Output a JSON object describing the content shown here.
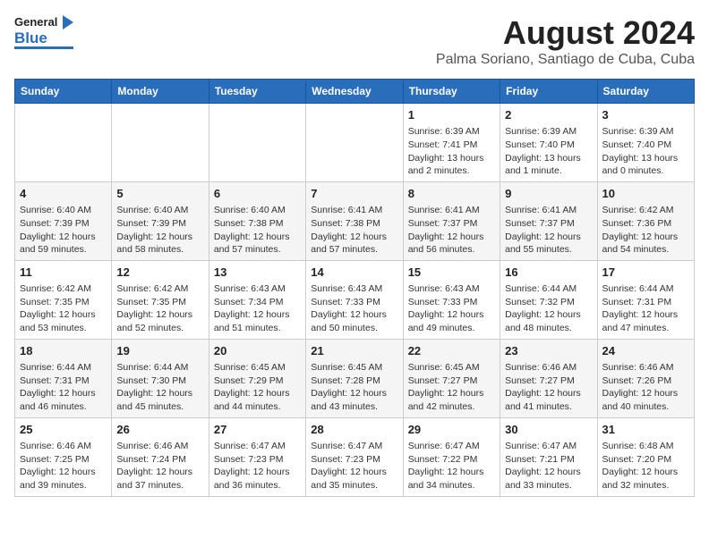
{
  "header": {
    "logo_general": "General",
    "logo_blue": "Blue",
    "title": "August 2024",
    "subtitle": "Palma Soriano, Santiago de Cuba, Cuba"
  },
  "days_of_week": [
    "Sunday",
    "Monday",
    "Tuesday",
    "Wednesday",
    "Thursday",
    "Friday",
    "Saturday"
  ],
  "weeks": [
    [
      {
        "num": "",
        "info": ""
      },
      {
        "num": "",
        "info": ""
      },
      {
        "num": "",
        "info": ""
      },
      {
        "num": "",
        "info": ""
      },
      {
        "num": "1",
        "info": "Sunrise: 6:39 AM\nSunset: 7:41 PM\nDaylight: 13 hours\nand 2 minutes."
      },
      {
        "num": "2",
        "info": "Sunrise: 6:39 AM\nSunset: 7:40 PM\nDaylight: 13 hours\nand 1 minute."
      },
      {
        "num": "3",
        "info": "Sunrise: 6:39 AM\nSunset: 7:40 PM\nDaylight: 13 hours\nand 0 minutes."
      }
    ],
    [
      {
        "num": "4",
        "info": "Sunrise: 6:40 AM\nSunset: 7:39 PM\nDaylight: 12 hours\nand 59 minutes."
      },
      {
        "num": "5",
        "info": "Sunrise: 6:40 AM\nSunset: 7:39 PM\nDaylight: 12 hours\nand 58 minutes."
      },
      {
        "num": "6",
        "info": "Sunrise: 6:40 AM\nSunset: 7:38 PM\nDaylight: 12 hours\nand 57 minutes."
      },
      {
        "num": "7",
        "info": "Sunrise: 6:41 AM\nSunset: 7:38 PM\nDaylight: 12 hours\nand 57 minutes."
      },
      {
        "num": "8",
        "info": "Sunrise: 6:41 AM\nSunset: 7:37 PM\nDaylight: 12 hours\nand 56 minutes."
      },
      {
        "num": "9",
        "info": "Sunrise: 6:41 AM\nSunset: 7:37 PM\nDaylight: 12 hours\nand 55 minutes."
      },
      {
        "num": "10",
        "info": "Sunrise: 6:42 AM\nSunset: 7:36 PM\nDaylight: 12 hours\nand 54 minutes."
      }
    ],
    [
      {
        "num": "11",
        "info": "Sunrise: 6:42 AM\nSunset: 7:35 PM\nDaylight: 12 hours\nand 53 minutes."
      },
      {
        "num": "12",
        "info": "Sunrise: 6:42 AM\nSunset: 7:35 PM\nDaylight: 12 hours\nand 52 minutes."
      },
      {
        "num": "13",
        "info": "Sunrise: 6:43 AM\nSunset: 7:34 PM\nDaylight: 12 hours\nand 51 minutes."
      },
      {
        "num": "14",
        "info": "Sunrise: 6:43 AM\nSunset: 7:33 PM\nDaylight: 12 hours\nand 50 minutes."
      },
      {
        "num": "15",
        "info": "Sunrise: 6:43 AM\nSunset: 7:33 PM\nDaylight: 12 hours\nand 49 minutes."
      },
      {
        "num": "16",
        "info": "Sunrise: 6:44 AM\nSunset: 7:32 PM\nDaylight: 12 hours\nand 48 minutes."
      },
      {
        "num": "17",
        "info": "Sunrise: 6:44 AM\nSunset: 7:31 PM\nDaylight: 12 hours\nand 47 minutes."
      }
    ],
    [
      {
        "num": "18",
        "info": "Sunrise: 6:44 AM\nSunset: 7:31 PM\nDaylight: 12 hours\nand 46 minutes."
      },
      {
        "num": "19",
        "info": "Sunrise: 6:44 AM\nSunset: 7:30 PM\nDaylight: 12 hours\nand 45 minutes."
      },
      {
        "num": "20",
        "info": "Sunrise: 6:45 AM\nSunset: 7:29 PM\nDaylight: 12 hours\nand 44 minutes."
      },
      {
        "num": "21",
        "info": "Sunrise: 6:45 AM\nSunset: 7:28 PM\nDaylight: 12 hours\nand 43 minutes."
      },
      {
        "num": "22",
        "info": "Sunrise: 6:45 AM\nSunset: 7:27 PM\nDaylight: 12 hours\nand 42 minutes."
      },
      {
        "num": "23",
        "info": "Sunrise: 6:46 AM\nSunset: 7:27 PM\nDaylight: 12 hours\nand 41 minutes."
      },
      {
        "num": "24",
        "info": "Sunrise: 6:46 AM\nSunset: 7:26 PM\nDaylight: 12 hours\nand 40 minutes."
      }
    ],
    [
      {
        "num": "25",
        "info": "Sunrise: 6:46 AM\nSunset: 7:25 PM\nDaylight: 12 hours\nand 39 minutes."
      },
      {
        "num": "26",
        "info": "Sunrise: 6:46 AM\nSunset: 7:24 PM\nDaylight: 12 hours\nand 37 minutes."
      },
      {
        "num": "27",
        "info": "Sunrise: 6:47 AM\nSunset: 7:23 PM\nDaylight: 12 hours\nand 36 minutes."
      },
      {
        "num": "28",
        "info": "Sunrise: 6:47 AM\nSunset: 7:23 PM\nDaylight: 12 hours\nand 35 minutes."
      },
      {
        "num": "29",
        "info": "Sunrise: 6:47 AM\nSunset: 7:22 PM\nDaylight: 12 hours\nand 34 minutes."
      },
      {
        "num": "30",
        "info": "Sunrise: 6:47 AM\nSunset: 7:21 PM\nDaylight: 12 hours\nand 33 minutes."
      },
      {
        "num": "31",
        "info": "Sunrise: 6:48 AM\nSunset: 7:20 PM\nDaylight: 12 hours\nand 32 minutes."
      }
    ]
  ]
}
